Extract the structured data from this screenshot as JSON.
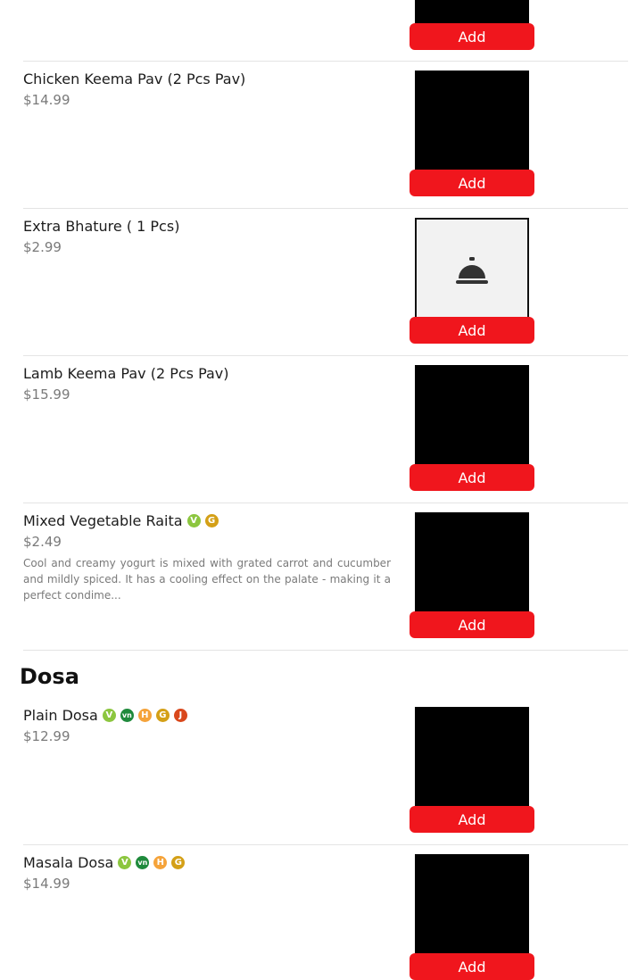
{
  "add_label": "Add",
  "items": [
    {
      "name": "Chicken Keema Pav (2 Pcs Pav)",
      "price": "$14.99"
    },
    {
      "name": "Extra Bhature ( 1 Pcs)",
      "price": "$2.99",
      "image_icon": "service-bell-icon"
    },
    {
      "name": "Lamb Keema Pav (2 Pcs Pav)",
      "price": "$15.99"
    },
    {
      "name": "Mixed Vegetable Raita",
      "price": "$2.49",
      "description": "Cool and creamy yogurt is mixed with grated carrot and cucumber and mildly spiced. It has a cooling effect on the palate - making it a perfect condime...",
      "badges": [
        "V",
        "G"
      ]
    },
    {
      "name": "Plain Dosa",
      "price": "$12.99",
      "badges": [
        "V",
        "vn",
        "H",
        "G",
        "J"
      ]
    },
    {
      "name": "Masala Dosa",
      "price": "$14.99",
      "badges": [
        "V",
        "vn",
        "H",
        "G"
      ]
    }
  ],
  "section": {
    "title": "Dosa"
  },
  "badge_colors": {
    "V": "#8cc63f",
    "vn": "#1f8a3c",
    "H": "#f5a33a",
    "G": "#d4a017",
    "J": "#d9481c"
  },
  "accent_color": "#f0161d"
}
